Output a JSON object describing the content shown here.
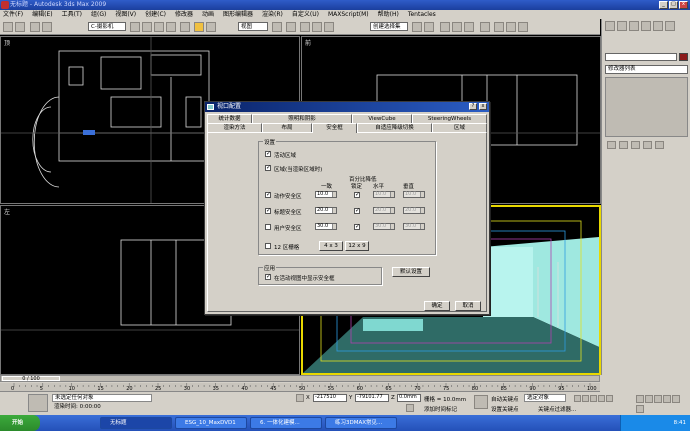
{
  "window": {
    "title": "无标题 - Autodesk 3ds Max 2009"
  },
  "menu": [
    "文件(F)",
    "编辑(E)",
    "工具(T)",
    "组(G)",
    "视图(V)",
    "创建(C)",
    "修改器",
    "动画",
    "图形编辑器",
    "渲染(R)",
    "自定义(U)",
    "MAXScript(M)",
    "帮助(H)",
    "Tentacles"
  ],
  "toolbar": {
    "ref_coord": "C-摄影机",
    "view_select": "视图",
    "named_sel": "创建选择集"
  },
  "viewports": {
    "top_left": "顶",
    "top_right": "前",
    "bottom_left": "左",
    "bottom_right": "透视"
  },
  "cmdpanel": {
    "modifier_list": "修改器列表"
  },
  "dialog": {
    "title": "视口配置",
    "tabs_row1": [
      "统计数据",
      "照明和阴影",
      "ViewCube",
      "SteeringWheels"
    ],
    "tabs_row2": [
      "渲染方法",
      "布局",
      "安全框",
      "自适应降级切换",
      "区域"
    ],
    "settings_group": "设置",
    "live_area": "活动区域",
    "region": "区域(当渲染区域时)",
    "percent_reduction": "百分比降低",
    "col_uniform": "一致",
    "col_lock": "锁定",
    "col_horizontal": "水平",
    "col_vertical": "垂直",
    "action_safe": "动作安全区",
    "title_safe": "标题安全区",
    "user_safe": "用户安全区",
    "action_values": [
      "10.0",
      "10.0",
      "10.0"
    ],
    "title_values": [
      "20.0",
      "20.0",
      "20.0"
    ],
    "user_values": [
      "30.0",
      "30.0",
      "30.0"
    ],
    "grid_label": "12 区栅格",
    "grid_btn1": "4 x 3",
    "grid_btn2": "12 x 9",
    "app_group": "应用",
    "show_safe": "在活动视图中显示安全框",
    "default_btn": "默认设置",
    "ok_btn": "确定",
    "cancel_btn": "取消"
  },
  "timeline": {
    "frame": "0 / 100",
    "ticks": [
      "0",
      "5",
      "10",
      "15",
      "20",
      "25",
      "30",
      "35",
      "40",
      "45",
      "50",
      "55",
      "60",
      "65",
      "70",
      "75",
      "80",
      "85",
      "90",
      "95",
      "100"
    ]
  },
  "status": {
    "selection": "未选定任何对象",
    "prompt": "渲染时间: 0:00:00",
    "x_val": "-217510",
    "y_val": "-79101.77",
    "z_val": "0.0mm",
    "grid": "栅格 = 10.0mm",
    "add_time_tag": "添加时间标记",
    "auto_key": "自动关键点",
    "set_key": "设置关键点",
    "selected_obj": "选定对象",
    "key_filters": "关键点过滤器..."
  },
  "taskbar": {
    "start": "开始",
    "tasks": [
      "无标题",
      "ESG_10_MaxDVD1",
      "6. 一体化建模...",
      "练习3DMAX常见..."
    ],
    "time": "8:41"
  }
}
